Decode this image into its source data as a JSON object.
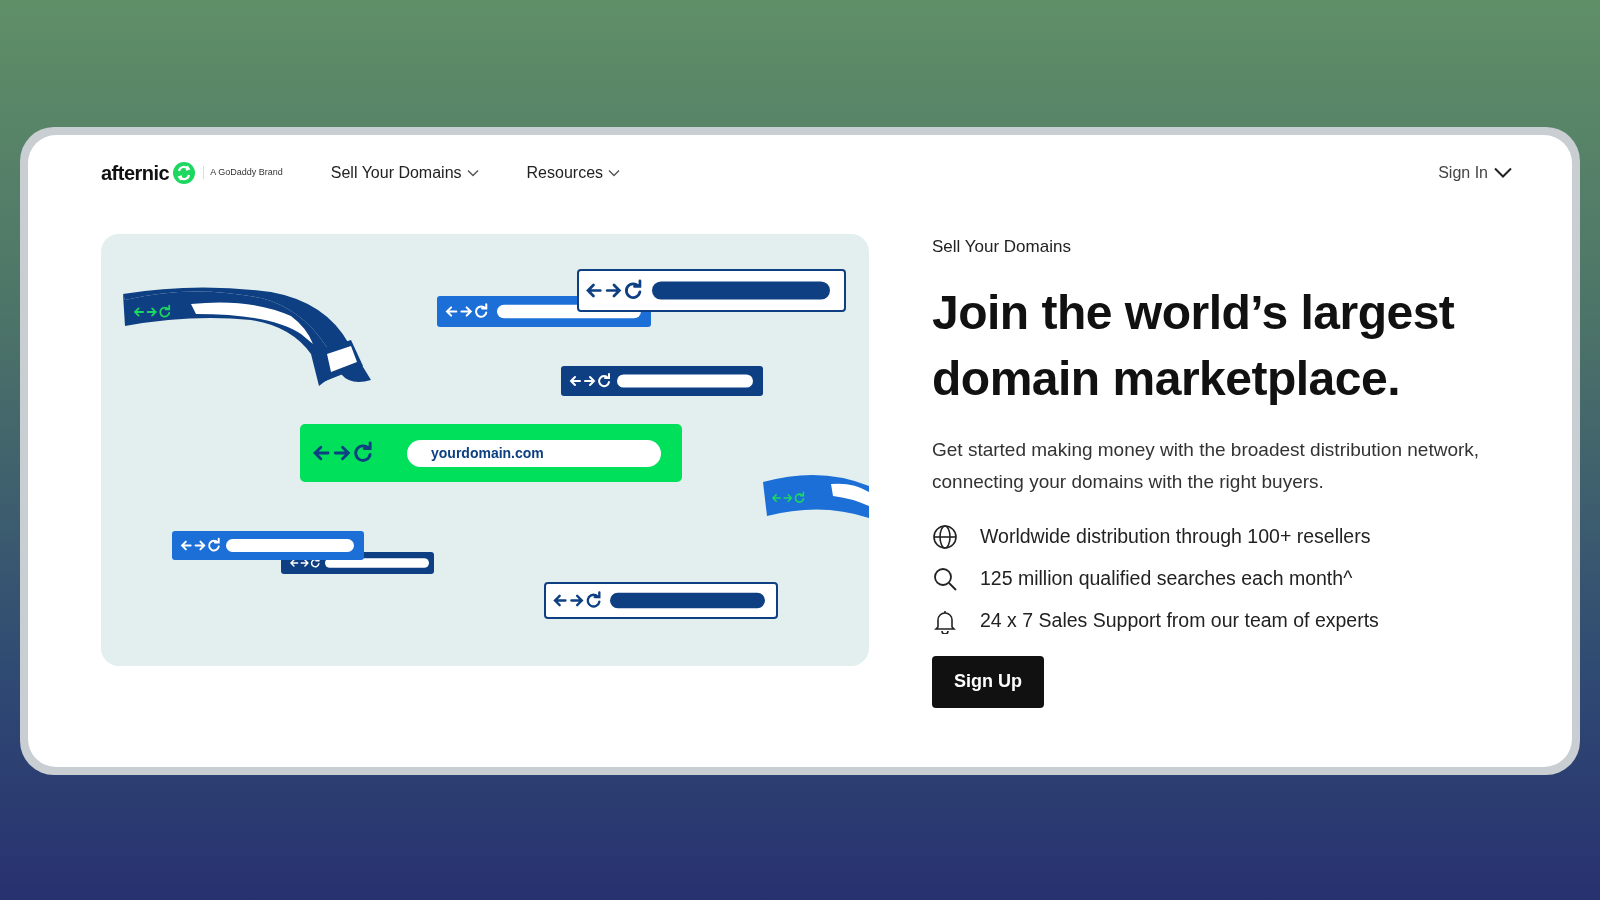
{
  "header": {
    "logo": "afternic",
    "brand_tagline": "A GoDaddy Brand",
    "nav": [
      {
        "label": "Sell Your Domains"
      },
      {
        "label": "Resources"
      }
    ],
    "sign_in": "Sign In"
  },
  "illustration": {
    "url_text": "yourdomain.com"
  },
  "hero": {
    "eyebrow": "Sell Your Domains",
    "heading_lines": [
      "Join the world’s largest",
      "domain marketplace."
    ],
    "description": "Get started making money with the broadest distribution network, connecting your domains with the right buyers.",
    "features": [
      {
        "kind": "globe",
        "text": "Worldwide distribution through 100+ resellers"
      },
      {
        "kind": "search",
        "text": "125 million qualified searches each month^"
      },
      {
        "kind": "bell",
        "text": "24 x 7 Sales Support from our team of experts"
      }
    ],
    "button": "Sign Up"
  }
}
